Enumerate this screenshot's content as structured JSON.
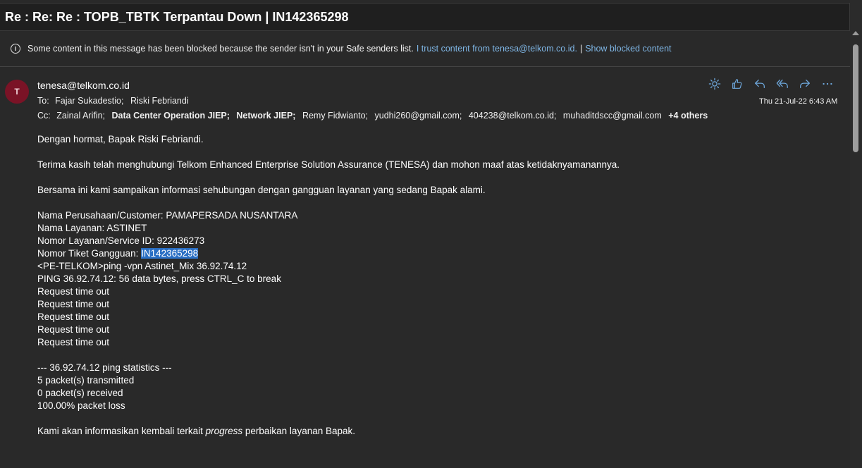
{
  "subject": "Re : Re: Re : TOPB_TBTK Terpantau Down | IN142365298",
  "info_bar": {
    "icon": "info-icon",
    "message": "Some content in this message has been blocked because the sender isn't in your Safe senders list.",
    "trust_link": "I trust content from tenesa@telkom.co.id.",
    "separator": "|",
    "show_link": "Show blocked content"
  },
  "email": {
    "avatar_initial": "T",
    "avatar_color": "#7a1326",
    "sender": "tenesa@telkom.co.id",
    "to_label": "To:",
    "to": [
      "Fajar Sukadestio;",
      "Riski Febriandi"
    ],
    "cc_label": "Cc:",
    "cc": [
      {
        "name": "Zainal Arifin;",
        "bold": false
      },
      {
        "name": "Data Center Operation JIEP;",
        "bold": true
      },
      {
        "name": "Network JIEP;",
        "bold": true
      },
      {
        "name": "Remy Fidwianto;",
        "bold": false
      },
      {
        "name": "yudhi260@gmail.com;",
        "bold": false
      },
      {
        "name": "404238@telkom.co.id;",
        "bold": false
      },
      {
        "name": "muhaditdscc@gmail.com",
        "bold": false
      }
    ],
    "others": "+4 others",
    "date": "Thu 21-Jul-22 6:43 AM",
    "actions": [
      "brightness-icon",
      "like-icon",
      "reply-icon",
      "reply-all-icon",
      "forward-icon",
      "more-icon"
    ]
  },
  "body": {
    "greeting": "Dengan hormat, Bapak Riski Febriandi.",
    "thanks": "Terima kasih telah menghubungi Telkom Enhanced Enterprise Solution Assurance (TENESA) dan mohon maaf atas ketidaknyamanannya.",
    "intro": "Bersama ini kami sampaikan informasi sehubungan dengan gangguan layanan yang sedang Bapak alami.",
    "customer": "Nama Perusahaan/Customer: PAMAPERSADA NUSANTARA",
    "service_name": "Nama Layanan: ASTINET",
    "service_id": "Nomor Layanan/Service ID: 922436273",
    "ticket_label": "Nomor Tiket Gangguan: ",
    "ticket_id": "IN142365298",
    "ping_cmd": "<PE-TELKOM>ping -vpn Astinet_Mix 36.92.74.12",
    "ping_header": "PING 36.92.74.12: 56 data bytes, press CTRL_C to break",
    "timeouts": [
      "Request time out",
      "Request time out",
      "Request time out",
      "Request time out",
      "Request time out"
    ],
    "stats_header": "--- 36.92.74.12 ping statistics ---",
    "transmitted": "5 packet(s) transmitted",
    "received": "0 packet(s) received",
    "loss": "100.00% packet loss",
    "closing_before": "Kami akan informasikan kembali terkait ",
    "closing_em": "progress",
    "closing_after": " perbaikan layanan Bapak."
  }
}
